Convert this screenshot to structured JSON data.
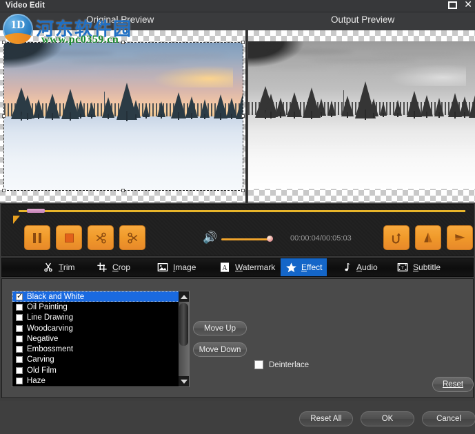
{
  "window": {
    "title": "Video Edit",
    "maximize_icon": "maximize-icon",
    "close_icon": "close-icon"
  },
  "previews": {
    "original_label": "Original Preview",
    "output_label": "Output Preview"
  },
  "watermark": {
    "logo_text": "1D",
    "chinese": "河东软件园",
    "url": "www.pc0359.cn"
  },
  "transport": {
    "pause_icon": "pause-icon",
    "stop_icon": "stop-icon",
    "cut_left_icon": "scissors-left-icon",
    "cut_right_icon": "scissors-right-icon",
    "volume_icon": "speaker-icon",
    "time_text": "00:00:04/00:05:03",
    "rotate_icon": "rotate-icon",
    "flip_vertical_icon": "flip-vertical-icon",
    "flip_horizontal_icon": "flip-horizontal-icon"
  },
  "tabs": [
    {
      "label": "Trim",
      "icon": "scissors-icon",
      "accel": "T",
      "active": false
    },
    {
      "label": "Crop",
      "icon": "crop-icon",
      "accel": "C",
      "active": false
    },
    {
      "label": "Image",
      "icon": "image-icon",
      "accel": "I",
      "active": false
    },
    {
      "label": "Watermark",
      "icon": "letter-a-icon",
      "accel": "W",
      "active": false
    },
    {
      "label": "Effect",
      "icon": "star-icon",
      "accel": "E",
      "active": true
    },
    {
      "label": "Audio",
      "icon": "music-note-icon",
      "accel": "A",
      "active": false
    },
    {
      "label": "Subtitle",
      "icon": "film-text-icon",
      "accel": "S",
      "active": false
    }
  ],
  "effects": {
    "items": [
      {
        "label": "Black and White",
        "checked": true,
        "selected": true
      },
      {
        "label": "Oil Painting",
        "checked": false,
        "selected": false
      },
      {
        "label": "Line Drawing",
        "checked": false,
        "selected": false
      },
      {
        "label": "Woodcarving",
        "checked": false,
        "selected": false
      },
      {
        "label": "Negative",
        "checked": false,
        "selected": false
      },
      {
        "label": "Embossment",
        "checked": false,
        "selected": false
      },
      {
        "label": "Carving",
        "checked": false,
        "selected": false
      },
      {
        "label": "Old Film",
        "checked": false,
        "selected": false
      },
      {
        "label": "Haze",
        "checked": false,
        "selected": false
      }
    ],
    "move_up": "Move Up",
    "move_down": "Move Down",
    "deinterlace": "Deinterlace",
    "deinterlace_checked": false,
    "reset": "Reset"
  },
  "footer": {
    "reset_all": "Reset All",
    "ok": "OK",
    "cancel": "Cancel"
  },
  "colors": {
    "accent_blue": "#1466c8",
    "orange": "#f09a2a",
    "timeline_yellow": "#e8b52a",
    "panel_gray": "#4a4a4a"
  }
}
